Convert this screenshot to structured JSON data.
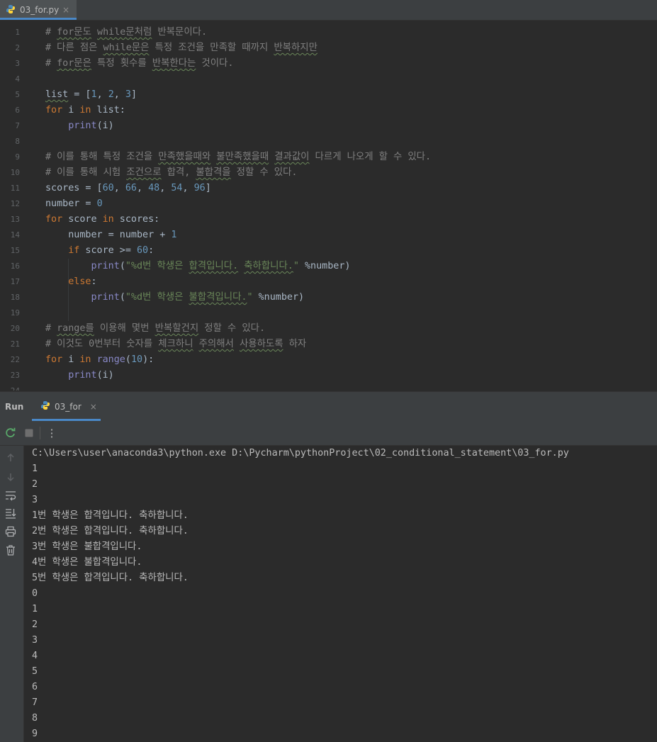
{
  "editor": {
    "tab": {
      "filename": "03_for.py",
      "close": "×"
    },
    "line_numbers": [
      "1",
      "2",
      "3",
      "4",
      "5",
      "6",
      "7",
      "8",
      "9",
      "10",
      "11",
      "12",
      "13",
      "14",
      "15",
      "16",
      "17",
      "18",
      "19",
      "20",
      "21",
      "22",
      "23",
      "24"
    ],
    "lines": [
      [
        {
          "t": "# ",
          "c": "cm"
        },
        {
          "t": "for문도",
          "c": "cm squig"
        },
        {
          "t": " ",
          "c": "cm"
        },
        {
          "t": "while문처럼",
          "c": "cm squig"
        },
        {
          "t": " 반복문이다.",
          "c": "cm"
        }
      ],
      [
        {
          "t": "# 다른 점은 ",
          "c": "cm"
        },
        {
          "t": "while문은",
          "c": "cm squig"
        },
        {
          "t": " 특정 조건을 만족할 때까지 ",
          "c": "cm"
        },
        {
          "t": "반복하지만",
          "c": "cm squig"
        }
      ],
      [
        {
          "t": "# ",
          "c": "cm"
        },
        {
          "t": "for문은",
          "c": "cm squig"
        },
        {
          "t": " 특정 횟수를 ",
          "c": "cm"
        },
        {
          "t": "반복한다는",
          "c": "cm squig"
        },
        {
          "t": " 것이다.",
          "c": "cm"
        }
      ],
      [],
      [
        {
          "t": "list",
          "c": "squig"
        },
        {
          "t": " = [",
          "c": ""
        },
        {
          "t": "1",
          "c": "num"
        },
        {
          "t": ", ",
          "c": ""
        },
        {
          "t": "2",
          "c": "num"
        },
        {
          "t": ", ",
          "c": ""
        },
        {
          "t": "3",
          "c": "num"
        },
        {
          "t": "]",
          "c": ""
        }
      ],
      [
        {
          "t": "for",
          "c": "kw"
        },
        {
          "t": " i ",
          "c": ""
        },
        {
          "t": "in",
          "c": "kw"
        },
        {
          "t": " list:",
          "c": ""
        }
      ],
      [
        {
          "t": "    ",
          "c": ""
        },
        {
          "t": "print",
          "c": "bi"
        },
        {
          "t": "(i)",
          "c": ""
        }
      ],
      [],
      [
        {
          "t": "# 이를 통해 특정 조건을 ",
          "c": "cm"
        },
        {
          "t": "만족했을때와",
          "c": "cm squig"
        },
        {
          "t": " ",
          "c": "cm"
        },
        {
          "t": "불만족했을때",
          "c": "cm squig"
        },
        {
          "t": " ",
          "c": "cm"
        },
        {
          "t": "결과값이",
          "c": "cm squig"
        },
        {
          "t": " 다르게 나오게 할 수 있다.",
          "c": "cm"
        }
      ],
      [
        {
          "t": "# 이를 통해 시험 ",
          "c": "cm"
        },
        {
          "t": "조건으로",
          "c": "cm squig"
        },
        {
          "t": " 합격, ",
          "c": "cm"
        },
        {
          "t": "불합격을",
          "c": "cm squig"
        },
        {
          "t": " 정할 수 있다.",
          "c": "cm"
        }
      ],
      [
        {
          "t": "scores = [",
          "c": ""
        },
        {
          "t": "60",
          "c": "num"
        },
        {
          "t": ", ",
          "c": ""
        },
        {
          "t": "66",
          "c": "num"
        },
        {
          "t": ", ",
          "c": ""
        },
        {
          "t": "48",
          "c": "num"
        },
        {
          "t": ", ",
          "c": ""
        },
        {
          "t": "54",
          "c": "num"
        },
        {
          "t": ", ",
          "c": ""
        },
        {
          "t": "96",
          "c": "num"
        },
        {
          "t": "]",
          "c": ""
        }
      ],
      [
        {
          "t": "number = ",
          "c": ""
        },
        {
          "t": "0",
          "c": "num"
        }
      ],
      [
        {
          "t": "for",
          "c": "kw"
        },
        {
          "t": " score ",
          "c": ""
        },
        {
          "t": "in",
          "c": "kw"
        },
        {
          "t": " scores:",
          "c": ""
        }
      ],
      [
        {
          "t": "    number = number + ",
          "c": ""
        },
        {
          "t": "1",
          "c": "num"
        }
      ],
      [
        {
          "t": "    ",
          "c": ""
        },
        {
          "t": "if",
          "c": "kw"
        },
        {
          "t": " score >= ",
          "c": ""
        },
        {
          "t": "60",
          "c": "num"
        },
        {
          "t": ":",
          "c": ""
        }
      ],
      [
        {
          "t": "        ",
          "c": ""
        },
        {
          "t": "print",
          "c": "bi"
        },
        {
          "t": "(",
          "c": ""
        },
        {
          "t": "\"%d번 학생은 ",
          "c": "str"
        },
        {
          "t": "합격입니다.",
          "c": "str squig"
        },
        {
          "t": " ",
          "c": "str"
        },
        {
          "t": "축하합니다.",
          "c": "str squig"
        },
        {
          "t": "\"",
          "c": "str"
        },
        {
          "t": " %number)",
          "c": ""
        }
      ],
      [
        {
          "t": "    ",
          "c": ""
        },
        {
          "t": "else",
          "c": "kw"
        },
        {
          "t": ":",
          "c": ""
        }
      ],
      [
        {
          "t": "        ",
          "c": ""
        },
        {
          "t": "print",
          "c": "bi"
        },
        {
          "t": "(",
          "c": ""
        },
        {
          "t": "\"%d번 학생은 ",
          "c": "str"
        },
        {
          "t": "불합격입니다.",
          "c": "str squig"
        },
        {
          "t": "\"",
          "c": "str"
        },
        {
          "t": " %number)",
          "c": ""
        }
      ],
      [],
      [
        {
          "t": "# ",
          "c": "cm"
        },
        {
          "t": "range를",
          "c": "cm squig"
        },
        {
          "t": " 이용해 몇번 ",
          "c": "cm"
        },
        {
          "t": "반복할건지",
          "c": "cm squig"
        },
        {
          "t": " 정할 수 있다.",
          "c": "cm"
        }
      ],
      [
        {
          "t": "# 이것도 0번부터 숫자를 ",
          "c": "cm"
        },
        {
          "t": "체크하니",
          "c": "cm squig"
        },
        {
          "t": " ",
          "c": "cm"
        },
        {
          "t": "주의해서",
          "c": "cm squig"
        },
        {
          "t": " ",
          "c": "cm"
        },
        {
          "t": "사용하도록",
          "c": "cm squig"
        },
        {
          "t": " 하자",
          "c": "cm"
        }
      ],
      [
        {
          "t": "for",
          "c": "kw"
        },
        {
          "t": " i ",
          "c": ""
        },
        {
          "t": "in",
          "c": "kw"
        },
        {
          "t": " ",
          "c": ""
        },
        {
          "t": "range",
          "c": "bi"
        },
        {
          "t": "(",
          "c": ""
        },
        {
          "t": "10",
          "c": "num"
        },
        {
          "t": "):",
          "c": ""
        }
      ],
      [
        {
          "t": "    ",
          "c": ""
        },
        {
          "t": "print",
          "c": "bi"
        },
        {
          "t": "(i)",
          "c": ""
        }
      ],
      []
    ]
  },
  "run": {
    "label": "Run",
    "tab": {
      "name": "03_for",
      "close": "×"
    },
    "toolbar": {
      "rerun_icon": "rerun-icon",
      "stop_icon": "stop-icon",
      "more": "⋮"
    },
    "output": [
      "C:\\Users\\user\\anaconda3\\python.exe D:\\Pycharm\\pythonProject\\02_conditional_statement\\03_for.py",
      "1",
      "2",
      "3",
      "1번 학생은 합격입니다. 축하합니다.",
      "2번 학생은 합격입니다. 축하합니다.",
      "3번 학생은 불합격입니다.",
      "4번 학생은 불합격입니다.",
      "5번 학생은 합격입니다. 축하합니다.",
      "0",
      "1",
      "2",
      "3",
      "4",
      "5",
      "6",
      "7",
      "8",
      "9"
    ]
  },
  "colors": {
    "background": "#2b2b2b",
    "panel": "#3c3f41",
    "accent": "#4a88c7",
    "keyword": "#cc7832",
    "number": "#6897bb",
    "string": "#6a8759",
    "comment": "#808080",
    "builtin": "#8888c6"
  }
}
